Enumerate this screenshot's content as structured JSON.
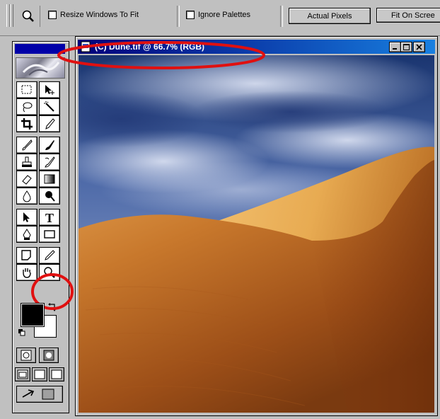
{
  "options_bar": {
    "tool_icon": "zoom-icon",
    "resize_windows": {
      "label": "Resize Windows To Fit",
      "checked": false
    },
    "ignore_palettes": {
      "label": "Ignore Palettes",
      "checked": false
    },
    "actual_pixels_label": "Actual Pixels",
    "fit_on_screen_label": "Fit On Scree"
  },
  "document": {
    "title": "(C) Dune.tif @ 66.7% (RGB)",
    "image_subject": "sand dune under cloudy sky"
  },
  "toolbox": {
    "tools": [
      "marquee-icon",
      "move-icon",
      "lasso-icon",
      "magic-wand-icon",
      "crop-icon",
      "slice-icon",
      "healing-brush-icon",
      "brush-icon",
      "clone-stamp-icon",
      "history-brush-icon",
      "eraser-icon",
      "gradient-icon",
      "blur-icon",
      "dodge-icon",
      "path-selection-icon",
      "type-icon",
      "pen-icon",
      "rectangle-icon",
      "notes-icon",
      "eyedropper-icon",
      "hand-icon",
      "zoom-icon"
    ],
    "foreground_color": "#000000",
    "background_color": "#ffffff"
  },
  "colors": {
    "annotation": "#e01010",
    "title_bar": "#00007a"
  }
}
